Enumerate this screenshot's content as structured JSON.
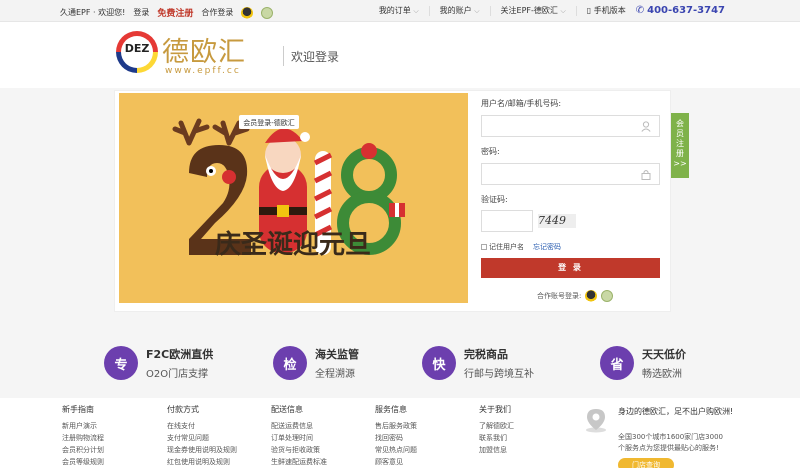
{
  "topbar": {
    "welcome": "久通EPF · 欢迎您!",
    "login": "登录",
    "register": "免费注册",
    "partner_login": "合作登录",
    "my_orders": "我的订单",
    "my_account": "我的账户",
    "follow": "关注EPF-德欧汇",
    "mobile": "手机版本",
    "phone": "400-637-3747"
  },
  "header": {
    "logo_badge": "DEZ",
    "logo_text": "德欧汇",
    "logo_url": "www.epff.cc",
    "title": "欢迎登录"
  },
  "banner": {
    "tag": "会员登录-德欧汇",
    "year": "2018",
    "greeting": "庆圣诞迎元旦"
  },
  "form": {
    "username_label": "用户名/邮箱/手机号码:",
    "password_label": "密码:",
    "captcha_label": "验证码:",
    "captcha_text": "7449",
    "remember": "记住用户名",
    "forgot": "忘记密码",
    "login_button": "登 录",
    "partner_account": "合作账号登录:"
  },
  "side_tab": {
    "label": "会员注册",
    "arrow": ">>"
  },
  "features": [
    {
      "icon": "专",
      "title": "F2C欧洲直供",
      "sub": "O2O门店支撑"
    },
    {
      "icon": "检",
      "title": "海关监管",
      "sub": "全程溯源"
    },
    {
      "icon": "快",
      "title": "完税商品",
      "sub": "行邮与跨境互补"
    },
    {
      "icon": "省",
      "title": "天天低价",
      "sub": "畅选欧洲"
    }
  ],
  "footer": {
    "columns": [
      {
        "heading": "新手指南",
        "links": [
          "新用户演示",
          "注册购物流程",
          "会员积分计划",
          "会员等级规则"
        ]
      },
      {
        "heading": "付款方式",
        "links": [
          "在线支付",
          "支付常见问题",
          "现金券使用说明及规则",
          "红包使用说明及规则"
        ]
      },
      {
        "heading": "配送信息",
        "links": [
          "配送运费信息",
          "订单处理时间",
          "验货与拒收政策",
          "生鲜速配运费标准"
        ]
      },
      {
        "heading": "服务信息",
        "links": [
          "售后服务政策",
          "找回密码",
          "常见热点问题",
          "顾客意见"
        ]
      },
      {
        "heading": "关于我们",
        "links": [
          "了解德欧汇",
          "联系我们",
          "加盟信息"
        ]
      }
    ],
    "right_title": "身边的德欧汇，足不出户购欧洲!",
    "right_desc": "全国300个城市1600家门店3000个服务点为您提供最贴心的服务!",
    "right_button": "门店查询"
  }
}
